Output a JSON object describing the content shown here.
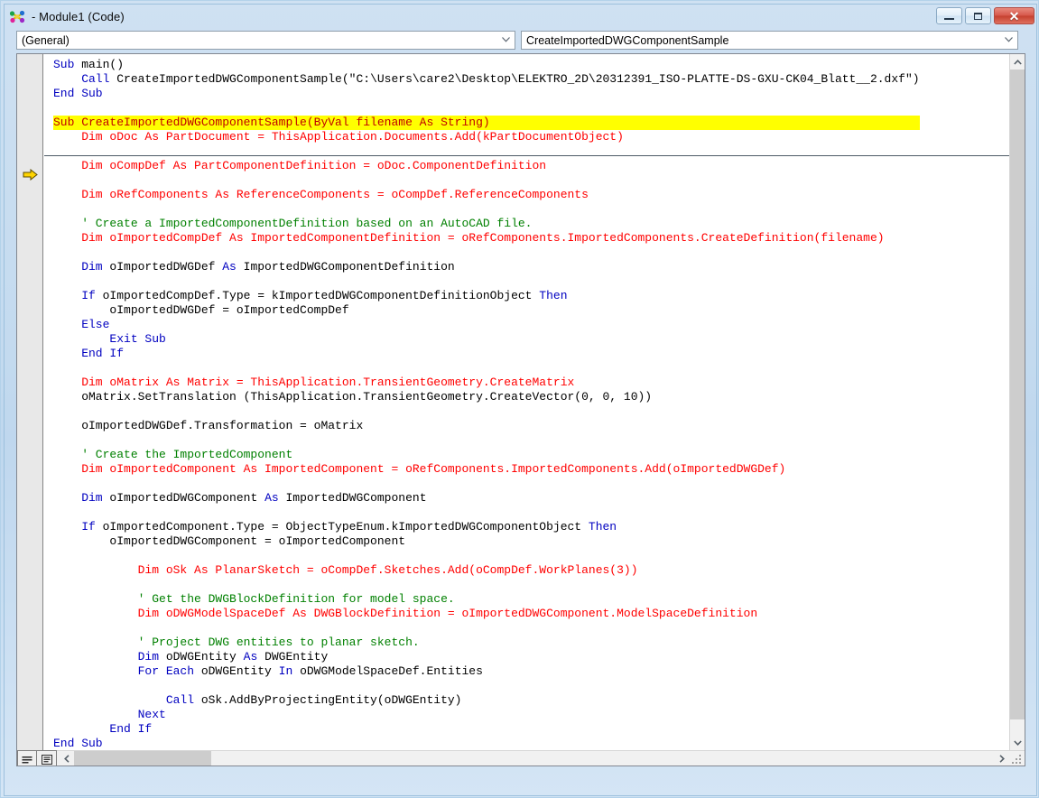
{
  "window": {
    "title": "- Module1 (Code)",
    "icon": "vba-module-icon",
    "minimize_label": "",
    "maximize_label": "",
    "close_label": "✕"
  },
  "toolbar": {
    "object_combo": {
      "value": "(General)",
      "icon": "chevron-down-icon"
    },
    "procedure_combo": {
      "value": "CreateImportedDWGComponentSample",
      "icon": "chevron-down-icon"
    }
  },
  "margin": {
    "execution_arrow": "execution-pointer-arrow"
  },
  "statusbar": {
    "procedure_view_label": "Procedure View",
    "full_module_view_label": "Full Module View",
    "scroll_left_icon": "chevron-left-icon",
    "scroll_right_icon": "chevron-right-icon",
    "resize_grip_icon": "resize-grip-icon"
  },
  "code": {
    "highlighted_line_index": 4,
    "lines": [
      {
        "indent": 0,
        "segments": [
          {
            "t": "Sub ",
            "c": "key"
          },
          {
            "t": "main()",
            "c": "txt"
          }
        ]
      },
      {
        "indent": 1,
        "segments": [
          {
            "t": "Call ",
            "c": "key"
          },
          {
            "t": "CreateImportedDWGComponentSample(\"C:\\Users\\care2\\Desktop\\ELEKTRO_2D\\20312391_ISO-PLATTE-DS-GXU-CK04_Blatt__2.dxf\")",
            "c": "txt"
          }
        ]
      },
      {
        "indent": 0,
        "segments": [
          {
            "t": "End Sub",
            "c": "key"
          }
        ]
      },
      {
        "indent": 0,
        "segments": []
      },
      {
        "indent": 0,
        "highlight": true,
        "segments": [
          {
            "t": "Sub CreateImportedDWGComponentSample(ByVal filename As String)",
            "c": "key"
          }
        ]
      },
      {
        "indent": 1,
        "segments": [
          {
            "t": "Dim oDoc As PartDocument = ThisApplication.Documents.Add(kPartDocumentObject)",
            "c": "err"
          }
        ]
      },
      {
        "indent": 0,
        "segments": []
      },
      {
        "indent": 1,
        "segments": [
          {
            "t": "Dim oCompDef As PartComponentDefinition = oDoc.ComponentDefinition",
            "c": "err"
          }
        ]
      },
      {
        "indent": 0,
        "segments": []
      },
      {
        "indent": 1,
        "segments": [
          {
            "t": "Dim oRefComponents As ReferenceComponents = oCompDef.ReferenceComponents",
            "c": "err"
          }
        ]
      },
      {
        "indent": 0,
        "segments": []
      },
      {
        "indent": 1,
        "segments": [
          {
            "t": "' Create a ImportedComponentDefinition based on an AutoCAD file.",
            "c": "cmt"
          }
        ]
      },
      {
        "indent": 1,
        "segments": [
          {
            "t": "Dim oImportedCompDef As ImportedComponentDefinition = oRefComponents.ImportedComponents.CreateDefinition(filename)",
            "c": "err"
          }
        ]
      },
      {
        "indent": 0,
        "segments": []
      },
      {
        "indent": 1,
        "segments": [
          {
            "t": "Dim ",
            "c": "key"
          },
          {
            "t": "oImportedDWGDef ",
            "c": "txt"
          },
          {
            "t": "As ",
            "c": "key"
          },
          {
            "t": "ImportedDWGComponentDefinition",
            "c": "txt"
          }
        ]
      },
      {
        "indent": 0,
        "segments": []
      },
      {
        "indent": 1,
        "segments": [
          {
            "t": "If ",
            "c": "key"
          },
          {
            "t": "oImportedCompDef.Type = kImportedDWGComponentDefinitionObject ",
            "c": "txt"
          },
          {
            "t": "Then",
            "c": "key"
          }
        ]
      },
      {
        "indent": 2,
        "segments": [
          {
            "t": "oImportedDWGDef = oImportedCompDef",
            "c": "txt"
          }
        ]
      },
      {
        "indent": 1,
        "segments": [
          {
            "t": "Else",
            "c": "key"
          }
        ]
      },
      {
        "indent": 2,
        "segments": [
          {
            "t": "Exit Sub",
            "c": "key"
          }
        ]
      },
      {
        "indent": 1,
        "segments": [
          {
            "t": "End If",
            "c": "key"
          }
        ]
      },
      {
        "indent": 0,
        "segments": []
      },
      {
        "indent": 1,
        "segments": [
          {
            "t": "Dim oMatrix As Matrix = ThisApplication.TransientGeometry.CreateMatrix",
            "c": "err"
          }
        ]
      },
      {
        "indent": 1,
        "segments": [
          {
            "t": "oMatrix.SetTranslation (ThisApplication.TransientGeometry.CreateVector(0, 0, 10))",
            "c": "txt"
          }
        ]
      },
      {
        "indent": 0,
        "segments": []
      },
      {
        "indent": 1,
        "segments": [
          {
            "t": "oImportedDWGDef.Transformation = oMatrix",
            "c": "txt"
          }
        ]
      },
      {
        "indent": 0,
        "segments": []
      },
      {
        "indent": 1,
        "segments": [
          {
            "t": "' Create the ImportedComponent",
            "c": "cmt"
          }
        ]
      },
      {
        "indent": 1,
        "segments": [
          {
            "t": "Dim oImportedComponent As ImportedComponent = oRefComponents.ImportedComponents.Add(oImportedDWGDef)",
            "c": "err"
          }
        ]
      },
      {
        "indent": 0,
        "segments": []
      },
      {
        "indent": 1,
        "segments": [
          {
            "t": "Dim ",
            "c": "key"
          },
          {
            "t": "oImportedDWGComponent ",
            "c": "txt"
          },
          {
            "t": "As ",
            "c": "key"
          },
          {
            "t": "ImportedDWGComponent",
            "c": "txt"
          }
        ]
      },
      {
        "indent": 0,
        "segments": []
      },
      {
        "indent": 1,
        "segments": [
          {
            "t": "If ",
            "c": "key"
          },
          {
            "t": "oImportedComponent.Type = ObjectTypeEnum.kImportedDWGComponentObject ",
            "c": "txt"
          },
          {
            "t": "Then",
            "c": "key"
          }
        ]
      },
      {
        "indent": 2,
        "segments": [
          {
            "t": "oImportedDWGComponent = oImportedComponent",
            "c": "txt"
          }
        ]
      },
      {
        "indent": 0,
        "segments": []
      },
      {
        "indent": 3,
        "segments": [
          {
            "t": "Dim oSk As PlanarSketch = oCompDef.Sketches.Add(oCompDef.WorkPlanes(3))",
            "c": "err"
          }
        ]
      },
      {
        "indent": 0,
        "segments": []
      },
      {
        "indent": 3,
        "segments": [
          {
            "t": "' Get the DWGBlockDefinition for model space.",
            "c": "cmt"
          }
        ]
      },
      {
        "indent": 3,
        "segments": [
          {
            "t": "Dim oDWGModelSpaceDef As DWGBlockDefinition = oImportedDWGComponent.ModelSpaceDefinition",
            "c": "err"
          }
        ]
      },
      {
        "indent": 0,
        "segments": []
      },
      {
        "indent": 3,
        "segments": [
          {
            "t": "' Project DWG entities to planar sketch.",
            "c": "cmt"
          }
        ]
      },
      {
        "indent": 3,
        "segments": [
          {
            "t": "Dim ",
            "c": "key"
          },
          {
            "t": "oDWGEntity ",
            "c": "txt"
          },
          {
            "t": "As ",
            "c": "key"
          },
          {
            "t": "DWGEntity",
            "c": "txt"
          }
        ]
      },
      {
        "indent": 3,
        "segments": [
          {
            "t": "For Each ",
            "c": "key"
          },
          {
            "t": "oDWGEntity ",
            "c": "txt"
          },
          {
            "t": "In ",
            "c": "key"
          },
          {
            "t": "oDWGModelSpaceDef.Entities",
            "c": "txt"
          }
        ]
      },
      {
        "indent": 0,
        "segments": []
      },
      {
        "indent": 4,
        "segments": [
          {
            "t": "Call ",
            "c": "key"
          },
          {
            "t": "oSk.AddByProjectingEntity(oDWGEntity)",
            "c": "txt"
          }
        ]
      },
      {
        "indent": 3,
        "segments": [
          {
            "t": "Next",
            "c": "key"
          }
        ]
      },
      {
        "indent": 2,
        "segments": [
          {
            "t": "End If",
            "c": "key"
          }
        ]
      },
      {
        "indent": 0,
        "segments": [
          {
            "t": "End Sub",
            "c": "key"
          }
        ]
      }
    ]
  },
  "colors": {
    "keyword": "#0000c0",
    "error": "#ff0000",
    "comment": "#008000",
    "highlight_bg": "#ffff00",
    "highlight_fg": "#c00000",
    "window_frame": "#cfe1f2"
  }
}
